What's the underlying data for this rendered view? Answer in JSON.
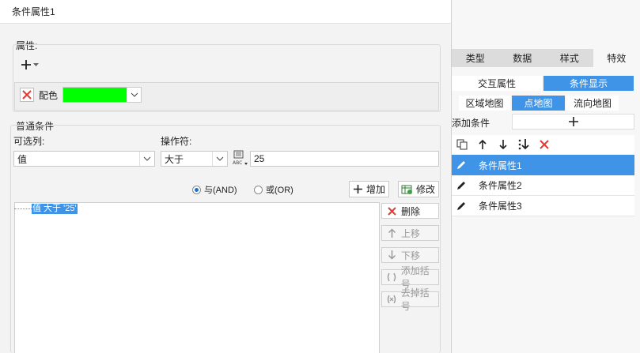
{
  "dialog": {
    "title": "条件属性1",
    "attr_section_label": "属性:",
    "color_label": "配色",
    "color_value": "#00ff00",
    "common_section_label": "普通条件",
    "optional_col_label": "可选列:",
    "optional_col_value": "值",
    "operator_label": "操作符:",
    "operator_value": "大于",
    "value_input": "25",
    "and_label": "与(AND)",
    "or_label": "或(OR)",
    "add_button": "增加",
    "modify_button": "修改",
    "condition_text": "值 大于 '25'",
    "delete_button": "删除",
    "move_up_button": "上移",
    "move_down_button": "下移",
    "add_bracket_button": "添加括号",
    "remove_bracket_button": "去掉括号"
  },
  "right_panel": {
    "tabs": [
      "类型",
      "数据",
      "样式",
      "特效"
    ],
    "subtabs": [
      "交互属性",
      "条件显示"
    ],
    "map_tabs": [
      "区域地图",
      "点地图",
      "流向地图"
    ],
    "add_condition_label": "添加条件",
    "list": [
      "条件属性1",
      "条件属性2",
      "条件属性3"
    ]
  },
  "colors": {
    "accent": "#3f94e8",
    "delete_red": "#e53935"
  }
}
